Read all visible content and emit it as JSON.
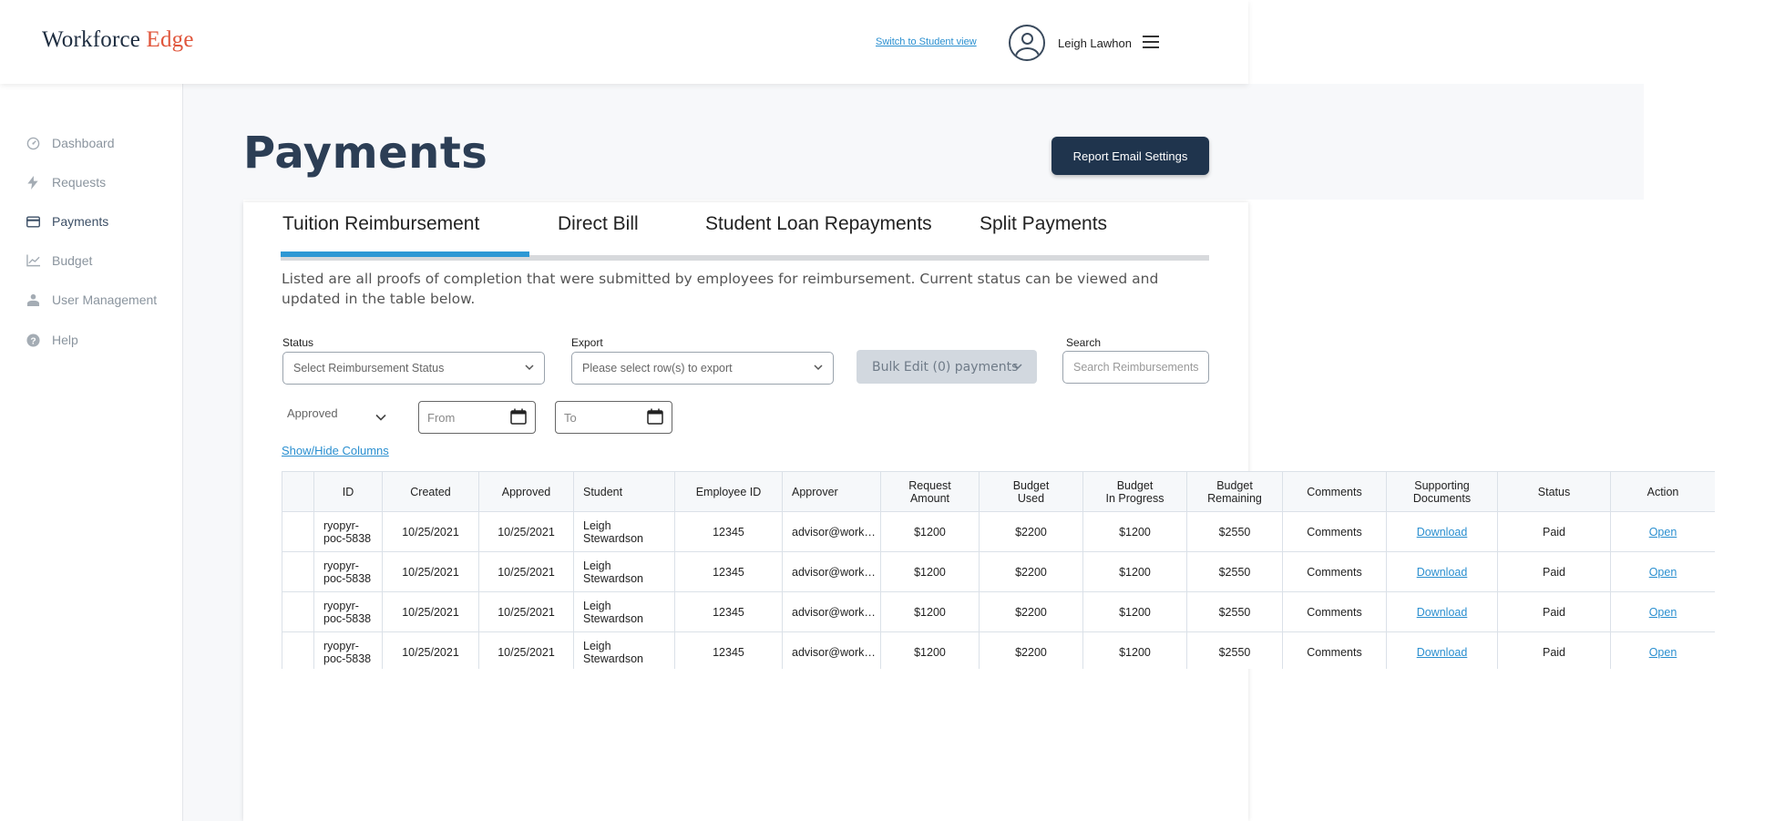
{
  "header": {
    "logo_main": "Workforce",
    "logo_accent": "Edge",
    "switch_view": "Switch to Student view",
    "user_name": "Leigh Lawhon"
  },
  "sidebar": {
    "items": [
      {
        "label": "Dashboard",
        "icon": "dashboard-icon"
      },
      {
        "label": "Requests",
        "icon": "bolt-icon"
      },
      {
        "label": "Payments",
        "icon": "credit-card-icon"
      },
      {
        "label": "Budget",
        "icon": "chart-icon"
      },
      {
        "label": "User Management",
        "icon": "user-icon"
      },
      {
        "label": "Help",
        "icon": "help-icon"
      }
    ],
    "active": "Payments"
  },
  "page": {
    "title": "Payments",
    "report_button": "Report Email Settings"
  },
  "tabs": [
    {
      "label": "Tuition Reimbursement",
      "active": true
    },
    {
      "label": "Direct Bill",
      "active": false
    },
    {
      "label": "Student Loan Repayments",
      "active": false
    },
    {
      "label": "Split Payments",
      "active": false
    }
  ],
  "description": "Listed are all proofs of completion that were submitted by employees for reimbursement. Current status can be viewed and updated in the table below.",
  "filters": {
    "status_label": "Status",
    "status_placeholder": "Select Reimbursement Status",
    "export_label": "Export",
    "export_placeholder": "Please select row(s) to export",
    "bulk_edit": "Bulk Edit (0) payments",
    "search_label": "Search",
    "search_placeholder": "Search Reimbursements",
    "date_type": "Approved",
    "from_placeholder": "From",
    "to_placeholder": "To",
    "show_hide": "Show/Hide Columns"
  },
  "table": {
    "headers": [
      "ID",
      "Created",
      "Approved",
      "Student",
      "Employee ID",
      "Approver",
      "Request Amount",
      "Budget Used",
      "Budget In Progress",
      "Budget Remaining",
      "Comments",
      "Supporting Documents",
      "Status",
      "Action"
    ],
    "header_lines": {
      "request_amount": [
        "Request",
        "Amount"
      ],
      "budget_used": [
        "Budget",
        "Used"
      ],
      "budget_in_progress": [
        "Budget",
        "In Progress"
      ],
      "budget_remaining": [
        "Budget",
        "Remaining"
      ],
      "supporting_documents": [
        "Supporting",
        "Documents"
      ]
    },
    "rows": [
      {
        "id_1": "ryopyr-",
        "id_2": "poc-5838",
        "created": "10/25/2021",
        "approved": "10/25/2021",
        "student_1": "Leigh",
        "student_2": "Stewardson",
        "employee_id": "12345",
        "approver": "advisor@workforceedge.com",
        "request_amount": "$1200",
        "budget_used": "$2200",
        "budget_in_progress": "$1200",
        "budget_remaining": "$2550",
        "comments": "Comments",
        "documents": "Download",
        "status": "Paid",
        "action": "Open"
      },
      {
        "id_1": "ryopyr-",
        "id_2": "poc-5838",
        "created": "10/25/2021",
        "approved": "10/25/2021",
        "student_1": "Leigh",
        "student_2": "Stewardson",
        "employee_id": "12345",
        "approver": "advisor@workforceedge.com",
        "request_amount": "$1200",
        "budget_used": "$2200",
        "budget_in_progress": "$1200",
        "budget_remaining": "$2550",
        "comments": "Comments",
        "documents": "Download",
        "status": "Paid",
        "action": "Open"
      },
      {
        "id_1": "ryopyr-",
        "id_2": "poc-5838",
        "created": "10/25/2021",
        "approved": "10/25/2021",
        "student_1": "Leigh",
        "student_2": "Stewardson",
        "employee_id": "12345",
        "approver": "advisor@workforceedge.com",
        "request_amount": "$1200",
        "budget_used": "$2200",
        "budget_in_progress": "$1200",
        "budget_remaining": "$2550",
        "comments": "Comments",
        "documents": "Download",
        "status": "Paid",
        "action": "Open"
      },
      {
        "id_1": "ryopyr-",
        "id_2": "poc-5838",
        "created": "10/25/2021",
        "approved": "10/25/2021",
        "student_1": "Leigh",
        "student_2": "Stewardson",
        "employee_id": "12345",
        "approver": "advisor@workforceedge.com",
        "request_amount": "$1200",
        "budget_used": "$2200",
        "budget_in_progress": "$1200",
        "budget_remaining": "$2550",
        "comments": "Comments",
        "documents": "Download",
        "status": "Paid",
        "action": "Open"
      }
    ]
  },
  "colors": {
    "brand_dark": "#1f344d",
    "brand_accent": "#e0553b",
    "tab_active": "#2e98d4",
    "link": "#2a8fd0"
  }
}
